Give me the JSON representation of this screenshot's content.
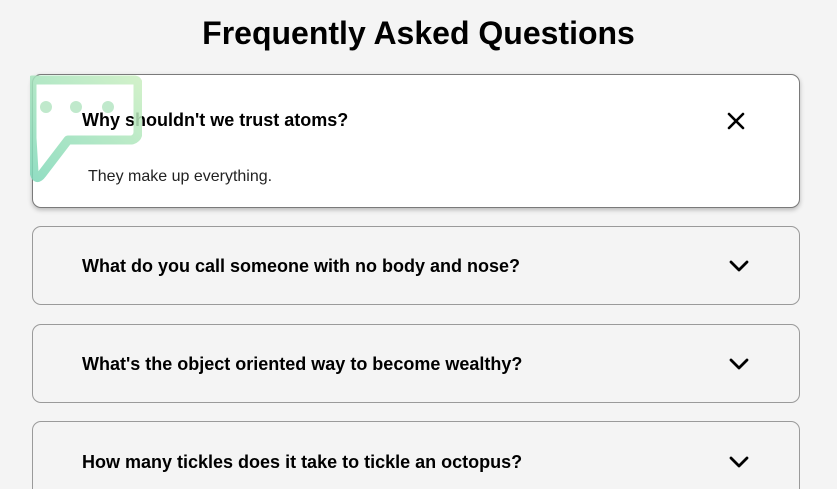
{
  "page": {
    "title": "Frequently Asked Questions"
  },
  "colors": {
    "background": "#f4f4f4",
    "active_card": "#ffffff",
    "border": "#9a9a9a",
    "deco_gradient_start": "#7fd8b8",
    "deco_gradient_end": "#c9eec0"
  },
  "faqs": [
    {
      "question": "Why shouldn't we trust atoms?",
      "answer": "They make up everything.",
      "expanded": true,
      "toggle_icon": "close-icon"
    },
    {
      "question": "What do you call someone with no body and nose?",
      "expanded": false,
      "toggle_icon": "chevron-down-icon"
    },
    {
      "question": "What's the object oriented way to become wealthy?",
      "expanded": false,
      "toggle_icon": "chevron-down-icon"
    },
    {
      "question": "How many tickles does it take to tickle an octopus?",
      "expanded": false,
      "toggle_icon": "chevron-down-icon"
    }
  ]
}
